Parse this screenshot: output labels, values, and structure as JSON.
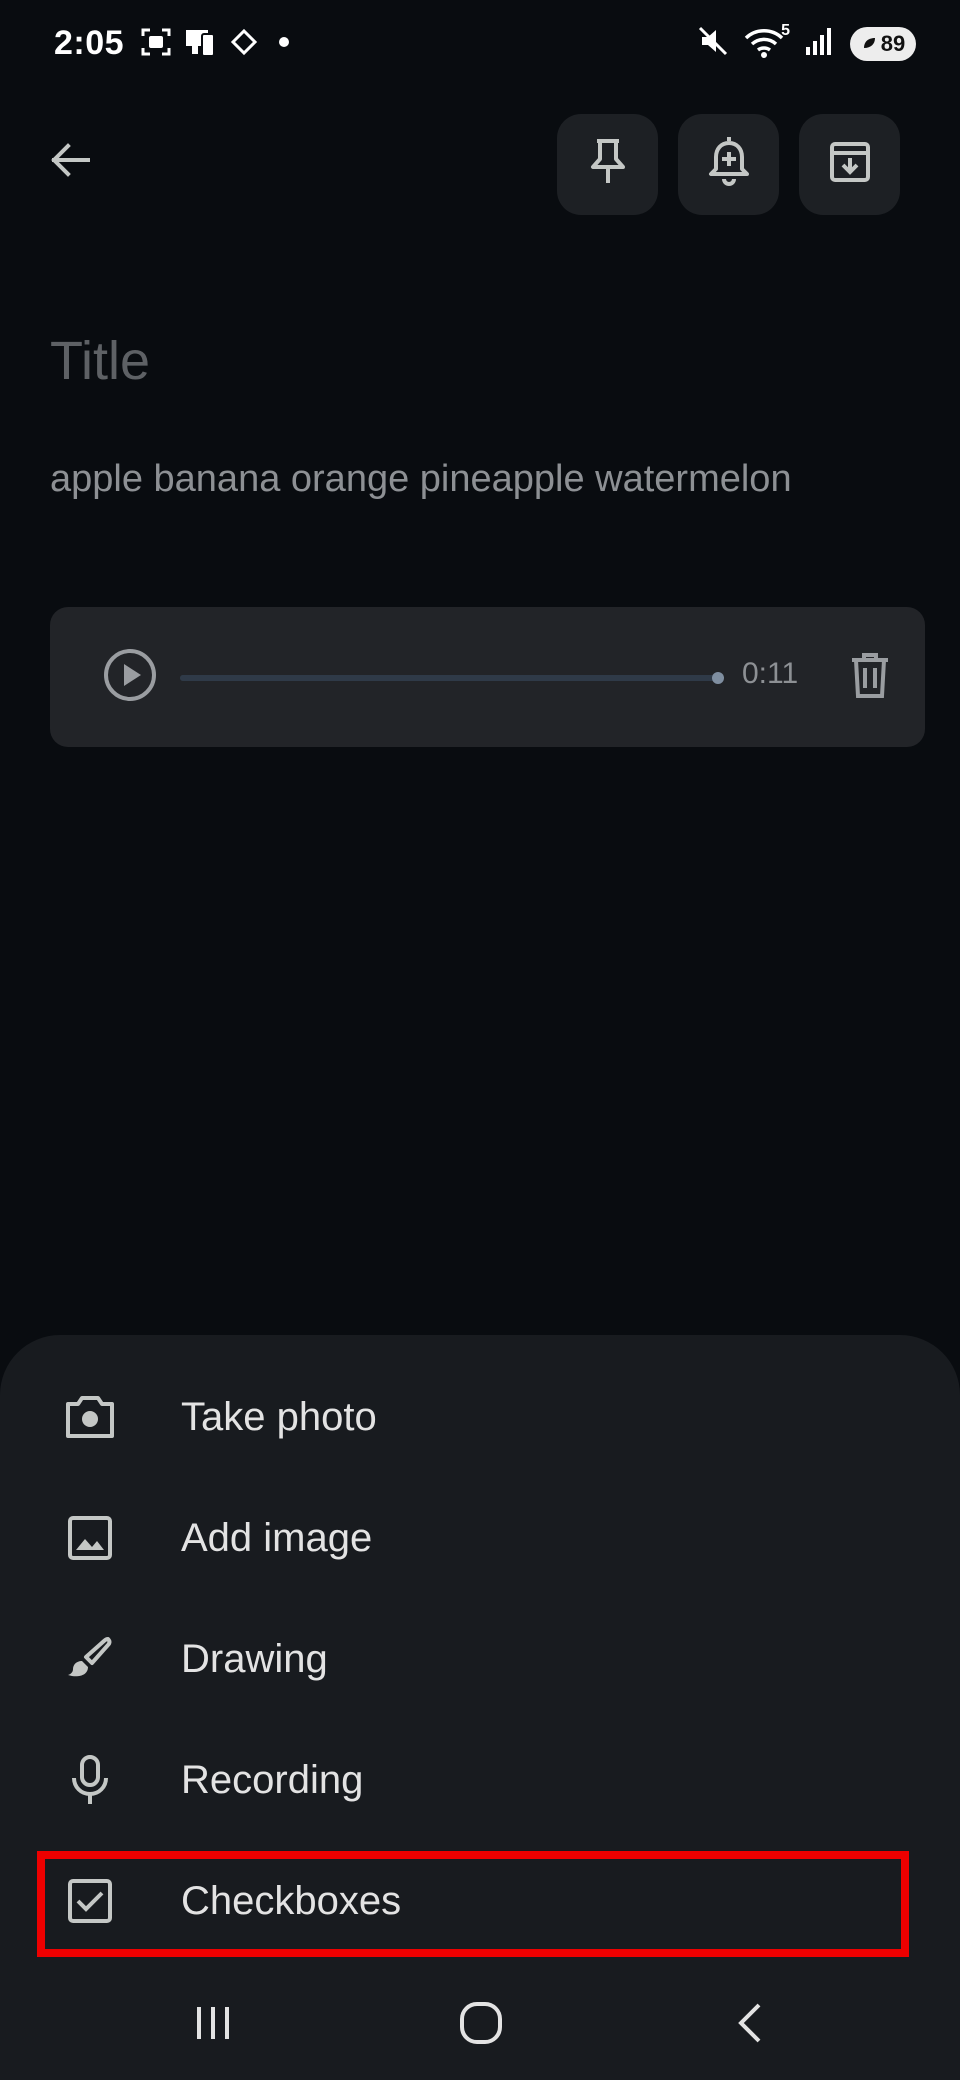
{
  "status_bar": {
    "time": "2:05",
    "wifi_band": "5",
    "battery_level": "89"
  },
  "top_bar": {
    "back_icon": "arrow-left-icon",
    "actions": [
      "pin-icon",
      "reminder-bell-icon",
      "archive-icon"
    ]
  },
  "note": {
    "title_placeholder": "Title",
    "body": "apple banana orange pineapple watermelon"
  },
  "audio_clip": {
    "duration": "0:11",
    "progress_percent": 100
  },
  "bottom_sheet": {
    "items": [
      {
        "label": "Take photo",
        "icon": "camera-icon"
      },
      {
        "label": "Add image",
        "icon": "image-icon"
      },
      {
        "label": "Drawing",
        "icon": "brush-icon"
      },
      {
        "label": "Recording",
        "icon": "microphone-icon"
      },
      {
        "label": "Checkboxes",
        "icon": "checkbox-icon"
      }
    ],
    "highlighted_item": "Checkboxes"
  },
  "nav_bar": {
    "buttons": [
      "recent-apps-icon",
      "home-icon",
      "back-nav-icon"
    ]
  },
  "colors": {
    "background": "#090c10",
    "sheet": "#181b1f",
    "highlight": "#ee0000",
    "icon": "#c4c7c5"
  }
}
